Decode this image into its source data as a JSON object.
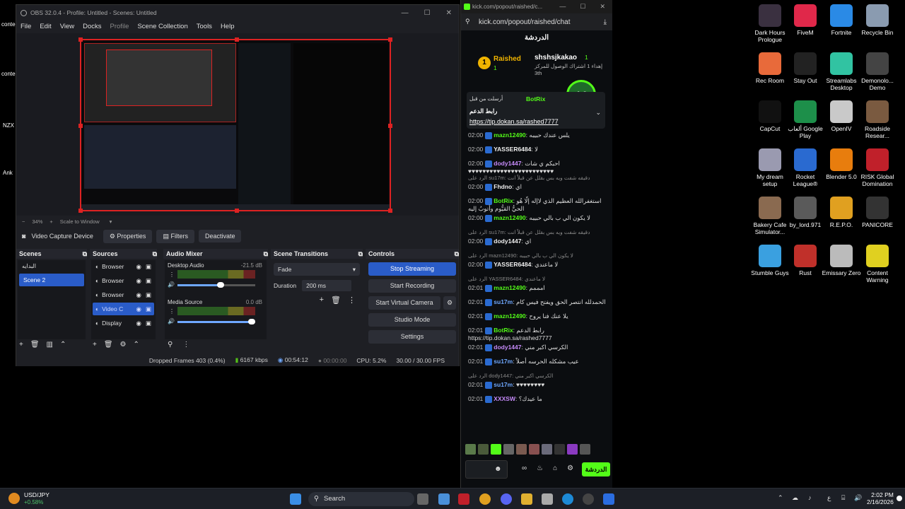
{
  "desktop": {
    "left_labels": [
      "conte",
      "conte",
      "NZX",
      "Ank"
    ],
    "icons": [
      {
        "label": "Dark Hours Prologue",
        "color": "#3a3040"
      },
      {
        "label": "FiveM",
        "color": "#e0284a"
      },
      {
        "label": "Fortnite",
        "color": "#2a8ae6"
      },
      {
        "label": "Recycle Bin",
        "color": "#8a9bb0"
      },
      {
        "label": "Rec Room",
        "color": "#e86a3a"
      },
      {
        "label": "Stay Out",
        "color": "#222222"
      },
      {
        "label": "Streamlabs Desktop",
        "color": "#31c3a2"
      },
      {
        "label": "Demonolo... Demo",
        "color": "#444444"
      },
      {
        "label": "CapCut",
        "color": "#111111"
      },
      {
        "label": "ألعاب Google Play",
        "color": "#1d8f4a"
      },
      {
        "label": "OpenIV",
        "color": "#c9c9c9"
      },
      {
        "label": "Roadside Resear...",
        "color": "#7a5a40"
      },
      {
        "label": "My dream setup",
        "color": "#9a9ab0"
      },
      {
        "label": "Rocket League®",
        "color": "#2a6ad0"
      },
      {
        "label": "Blender 5.0",
        "color": "#e87d0d"
      },
      {
        "label": "RISK Global Domination",
        "color": "#c0202a"
      },
      {
        "label": "Bakery Cafe Simulator...",
        "color": "#8a6a50"
      },
      {
        "label": "by_lord.971",
        "color": "#5a5a5a"
      },
      {
        "label": "R.E.P.O.",
        "color": "#e0a020"
      },
      {
        "label": "PANICORE",
        "color": "#333333"
      },
      {
        "label": "Stumble Guys",
        "color": "#3aa0e0"
      },
      {
        "label": "Rust",
        "color": "#c0302a"
      },
      {
        "label": "Emissary Zero",
        "color": "#bbbbbb"
      },
      {
        "label": "Content Warning",
        "color": "#e0d020"
      }
    ]
  },
  "obs": {
    "title": "OBS 32.0.4 - Profile: Untitled - Scenes: Untitled",
    "menu": [
      "File",
      "Edit",
      "View",
      "Docks",
      "Profile",
      "Scene Collection",
      "Tools",
      "Help"
    ],
    "zoom": "34%",
    "scale_mode": "Scale to Window",
    "source_name": "Video Capture Device",
    "properties": "Properties",
    "filters": "Filters",
    "deactivate": "Deactivate",
    "scenes": {
      "title": "Scenes",
      "items": [
        "البدايه",
        "Scene 2"
      ],
      "selected": 1
    },
    "sources": {
      "title": "Sources",
      "items": [
        "Browser",
        "Browser",
        "Browser",
        "Video C",
        "Display"
      ]
    },
    "mixer": {
      "title": "Audio Mixer",
      "channels": [
        {
          "name": "Desktop Audio",
          "db": "-21.5 dB",
          "level": 0.55
        },
        {
          "name": "Media Source",
          "db": "0.0 dB",
          "level": 0.95
        }
      ]
    },
    "transitions": {
      "title": "Scene Transitions",
      "type": "Fade",
      "duration_label": "Duration",
      "duration": "200 ms"
    },
    "controls": {
      "title": "Controls",
      "buttons": [
        "Stop Streaming",
        "Start Recording",
        "Start Virtual Camera",
        "Studio Mode",
        "Settings"
      ]
    },
    "status": {
      "dropped": "Dropped Frames 403 (0.4%)",
      "kbps": "6167 kbps",
      "live": "00:54:12",
      "rec": "00:00:00",
      "cpu": "CPU: 5.2%",
      "fps": "30.00 / 30.00 FPS"
    }
  },
  "chat": {
    "window_title": "kick.com/popout/raished/c...",
    "url": "kick.com/popout/raished/chat",
    "header": "الدردشة",
    "leader": {
      "rank": "1",
      "name": "Raished",
      "count": "1",
      "user": "shshsjkakao",
      "user_count": "1",
      "line": "إهداء 1 اشتراك الوصول للمركز",
      "rank_text": "3th"
    },
    "rating": "4.6",
    "pinned": {
      "by": "أرسلت من قبل",
      "user": "BotRix",
      "title": "رابط الدعم",
      "link": "https://tip.dokan.sa/rashed7777"
    },
    "messages": [
      {
        "time": "02:00",
        "user": "mazn12490",
        "cls": "u",
        "text": "يلس عندك حبيبه"
      },
      {
        "time": "02:00",
        "user": "YASSER6484",
        "cls": "u4",
        "text": "لا"
      },
      {
        "time": "02:00",
        "user": "dody1447",
        "cls": "u3",
        "text": "احبكم ي شات ♥♥♥♥♥♥♥♥♥♥♥♥♥♥♥♥♥♥♥♥♥♥♥♥"
      },
      {
        "time": "02:00",
        "user": "Fhdno",
        "cls": "u4",
        "text": "اي",
        "reply": "الرد على su17m: دقيقه شفت ويه بس بقلل عن قبلاً انت"
      },
      {
        "time": "02:00",
        "user": "BotRix",
        "cls": "u",
        "text": "استغفرالله العظيم الذي لاإله إلّا هُو الحيُّ القيُّوم وأتوبُ إليه"
      },
      {
        "time": "02:00",
        "user": "mazn12490",
        "cls": "u",
        "text": "لا يكون الي ب بالي حبيبه"
      },
      {
        "time": "02:00",
        "user": "dody1447",
        "cls": "u4",
        "text": "اي",
        "reply": "الرد على su17m: دقيقه شفت ويه بس بقلل عن قبلاً انت"
      },
      {
        "time": "02:00",
        "user": "YASSER6484",
        "cls": "u4",
        "text": "لا ماعندي",
        "reply": "الرد على mazn12490: لا يكون الي ب بالي حبيبه"
      },
      {
        "time": "02:01",
        "user": "mazn12490",
        "cls": "u",
        "text": "امممم",
        "reply": "الرد على YASSER6484: لا ماعندي"
      },
      {
        "time": "02:01",
        "user": "su17m",
        "cls": "u2",
        "text": "الحمدلله انتصر الحق ويفتح فيس كام"
      },
      {
        "time": "02:01",
        "user": "mazn12490",
        "cls": "u",
        "text": "يلا عنك فنا يروح"
      },
      {
        "time": "02:01",
        "user": "BotRix",
        "cls": "u",
        "text": "رابط الدعم https://tip.dokan.sa/rashed7777"
      },
      {
        "time": "02:01",
        "user": "dody1447",
        "cls": "u3",
        "text": "الكرسي اكبر مني"
      },
      {
        "time": "02:01",
        "user": "su17m",
        "cls": "u2",
        "text": "عيب مشكله الحرسه أصلاً"
      },
      {
        "time": "02:01",
        "user": "su17m",
        "cls": "u2",
        "text": "♥♥♥♥♥♥♥♥",
        "reply": "الرد على dody1447: الكرسي اكبر مني"
      },
      {
        "time": "02:01",
        "user": "XXXSW",
        "cls": "u3",
        "text": "ما عيدك؟"
      }
    ],
    "send_label": "الدردشة"
  },
  "taskbar": {
    "ticker": "USD/JPY",
    "ticker_change": "+0.58%",
    "search": "Search",
    "time": "2:02 PM",
    "date": "2/16/2026",
    "lang": "ع"
  }
}
